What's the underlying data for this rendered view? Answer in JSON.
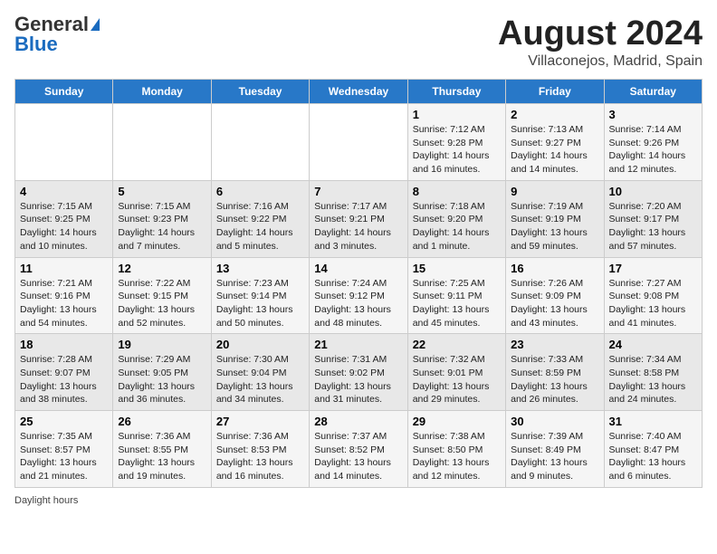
{
  "header": {
    "logo_general": "General",
    "logo_blue": "Blue",
    "title": "August 2024",
    "subtitle": "Villaconejos, Madrid, Spain"
  },
  "days_of_week": [
    "Sunday",
    "Monday",
    "Tuesday",
    "Wednesday",
    "Thursday",
    "Friday",
    "Saturday"
  ],
  "weeks": [
    [
      {
        "day": "",
        "content": ""
      },
      {
        "day": "",
        "content": ""
      },
      {
        "day": "",
        "content": ""
      },
      {
        "day": "",
        "content": ""
      },
      {
        "day": "1",
        "content": "Sunrise: 7:12 AM\nSunset: 9:28 PM\nDaylight: 14 hours and 16 minutes."
      },
      {
        "day": "2",
        "content": "Sunrise: 7:13 AM\nSunset: 9:27 PM\nDaylight: 14 hours and 14 minutes."
      },
      {
        "day": "3",
        "content": "Sunrise: 7:14 AM\nSunset: 9:26 PM\nDaylight: 14 hours and 12 minutes."
      }
    ],
    [
      {
        "day": "4",
        "content": "Sunrise: 7:15 AM\nSunset: 9:25 PM\nDaylight: 14 hours and 10 minutes."
      },
      {
        "day": "5",
        "content": "Sunrise: 7:15 AM\nSunset: 9:23 PM\nDaylight: 14 hours and 7 minutes."
      },
      {
        "day": "6",
        "content": "Sunrise: 7:16 AM\nSunset: 9:22 PM\nDaylight: 14 hours and 5 minutes."
      },
      {
        "day": "7",
        "content": "Sunrise: 7:17 AM\nSunset: 9:21 PM\nDaylight: 14 hours and 3 minutes."
      },
      {
        "day": "8",
        "content": "Sunrise: 7:18 AM\nSunset: 9:20 PM\nDaylight: 14 hours and 1 minute."
      },
      {
        "day": "9",
        "content": "Sunrise: 7:19 AM\nSunset: 9:19 PM\nDaylight: 13 hours and 59 minutes."
      },
      {
        "day": "10",
        "content": "Sunrise: 7:20 AM\nSunset: 9:17 PM\nDaylight: 13 hours and 57 minutes."
      }
    ],
    [
      {
        "day": "11",
        "content": "Sunrise: 7:21 AM\nSunset: 9:16 PM\nDaylight: 13 hours and 54 minutes."
      },
      {
        "day": "12",
        "content": "Sunrise: 7:22 AM\nSunset: 9:15 PM\nDaylight: 13 hours and 52 minutes."
      },
      {
        "day": "13",
        "content": "Sunrise: 7:23 AM\nSunset: 9:14 PM\nDaylight: 13 hours and 50 minutes."
      },
      {
        "day": "14",
        "content": "Sunrise: 7:24 AM\nSunset: 9:12 PM\nDaylight: 13 hours and 48 minutes."
      },
      {
        "day": "15",
        "content": "Sunrise: 7:25 AM\nSunset: 9:11 PM\nDaylight: 13 hours and 45 minutes."
      },
      {
        "day": "16",
        "content": "Sunrise: 7:26 AM\nSunset: 9:09 PM\nDaylight: 13 hours and 43 minutes."
      },
      {
        "day": "17",
        "content": "Sunrise: 7:27 AM\nSunset: 9:08 PM\nDaylight: 13 hours and 41 minutes."
      }
    ],
    [
      {
        "day": "18",
        "content": "Sunrise: 7:28 AM\nSunset: 9:07 PM\nDaylight: 13 hours and 38 minutes."
      },
      {
        "day": "19",
        "content": "Sunrise: 7:29 AM\nSunset: 9:05 PM\nDaylight: 13 hours and 36 minutes."
      },
      {
        "day": "20",
        "content": "Sunrise: 7:30 AM\nSunset: 9:04 PM\nDaylight: 13 hours and 34 minutes."
      },
      {
        "day": "21",
        "content": "Sunrise: 7:31 AM\nSunset: 9:02 PM\nDaylight: 13 hours and 31 minutes."
      },
      {
        "day": "22",
        "content": "Sunrise: 7:32 AM\nSunset: 9:01 PM\nDaylight: 13 hours and 29 minutes."
      },
      {
        "day": "23",
        "content": "Sunrise: 7:33 AM\nSunset: 8:59 PM\nDaylight: 13 hours and 26 minutes."
      },
      {
        "day": "24",
        "content": "Sunrise: 7:34 AM\nSunset: 8:58 PM\nDaylight: 13 hours and 24 minutes."
      }
    ],
    [
      {
        "day": "25",
        "content": "Sunrise: 7:35 AM\nSunset: 8:57 PM\nDaylight: 13 hours and 21 minutes."
      },
      {
        "day": "26",
        "content": "Sunrise: 7:36 AM\nSunset: 8:55 PM\nDaylight: 13 hours and 19 minutes."
      },
      {
        "day": "27",
        "content": "Sunrise: 7:36 AM\nSunset: 8:53 PM\nDaylight: 13 hours and 16 minutes."
      },
      {
        "day": "28",
        "content": "Sunrise: 7:37 AM\nSunset: 8:52 PM\nDaylight: 13 hours and 14 minutes."
      },
      {
        "day": "29",
        "content": "Sunrise: 7:38 AM\nSunset: 8:50 PM\nDaylight: 13 hours and 12 minutes."
      },
      {
        "day": "30",
        "content": "Sunrise: 7:39 AM\nSunset: 8:49 PM\nDaylight: 13 hours and 9 minutes."
      },
      {
        "day": "31",
        "content": "Sunrise: 7:40 AM\nSunset: 8:47 PM\nDaylight: 13 hours and 6 minutes."
      }
    ]
  ],
  "footer": {
    "daylight_label": "Daylight hours"
  }
}
